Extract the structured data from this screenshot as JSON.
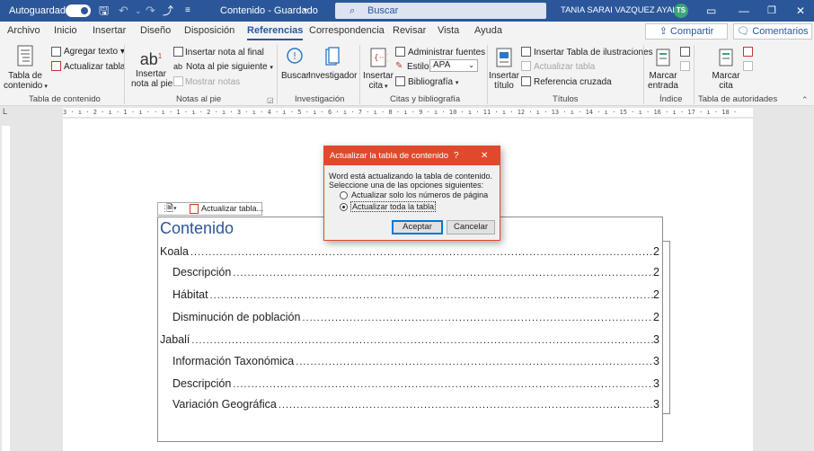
{
  "titlebar": {
    "autosave_label": "Autoguardado",
    "document_title": "Contenido  -  Guardado",
    "search_placeholder": "Buscar",
    "user_name": "TANIA SARAI VAZQUEZ AYALA",
    "user_initials": "TS"
  },
  "tabs": [
    "Archivo",
    "Inicio",
    "Insertar",
    "Diseño",
    "Disposición",
    "Referencias",
    "Correspondencia",
    "Revisar",
    "Vista",
    "Ayuda"
  ],
  "active_tab": "Referencias",
  "share_label": "Compartir",
  "comments_label": "Comentarios",
  "ribbon": {
    "toc_button": "Tabla de",
    "toc_button2": "contenido",
    "add_text": "Agregar texto",
    "update_table": "Actualizar tabla",
    "group_toc": "Tabla de contenido",
    "insert_footnote": "Insertar",
    "insert_footnote2": "nota al pie",
    "insert_endnote": "Insertar nota al final",
    "next_footnote": "Nota al pie siguiente",
    "show_notes": "Mostrar notas",
    "group_footnotes": "Notas al pie",
    "search": "Buscar",
    "researcher": "Investigador",
    "group_research": "Investigación",
    "insert_citation": "Insertar",
    "insert_citation2": "cita",
    "manage_sources": "Administrar fuentes",
    "style_label": "Estilo:",
    "style_value": "APA",
    "bibliography": "Bibliografía",
    "group_citations": "Citas y bibliografía",
    "insert_caption": "Insertar",
    "insert_caption2": "título",
    "insert_table_figures": "Insertar Tabla de ilustraciones",
    "update_table_figures": "Actualizar tabla",
    "cross_reference": "Referencia cruzada",
    "group_captions": "Títulos",
    "mark_entry": "Marcar",
    "mark_entry2": "entrada",
    "group_index": "Índice",
    "mark_citation": "Marcar",
    "mark_citation2": "cita",
    "group_authorities": "Tabla de autoridades"
  },
  "ruler_text": "3 · ı · 2 · ı · 1 · ı ·   · ı · 1 · ı · 2 · ı · 3 · ı · 4 · ı · 5 · ı · 6 · ı · 7 · ı · 8 · ı · 9 · ı · 10 · ı · 11 · ı · 12 · ı · 13 · ı · 14 · ı · 15 · ı · 16 · ı · 17 · ı · 18 ·",
  "toc_toolbar_label": "Actualizar tabla...",
  "toc": {
    "title": "Contenido",
    "entries": [
      {
        "text": "Koala",
        "page": "2",
        "level": 1
      },
      {
        "text": "Descripción",
        "page": "2",
        "level": 2
      },
      {
        "text": "Hábitat",
        "page": "2",
        "level": 2
      },
      {
        "text": "Disminución de población",
        "page": "2",
        "level": 2
      },
      {
        "text": "Jabalí",
        "page": "3",
        "level": 1
      },
      {
        "text": "Información Taxonómica",
        "page": "3",
        "level": 2
      },
      {
        "text": "Descripción",
        "page": "3",
        "level": 2
      },
      {
        "text": "Variación Geográfica",
        "page": "3",
        "level": 2
      }
    ]
  },
  "dialog": {
    "title": "Actualizar la tabla de contenido",
    "help": "?",
    "close": "✕",
    "message1": "Word está actualizando la tabla de contenido.",
    "message2": "Seleccione una de las opciones siguientes:",
    "option1": "Actualizar solo los números de página",
    "option2": "Actualizar toda la tabla",
    "selected_option": "option2",
    "ok": "Aceptar",
    "cancel": "Cancelar"
  }
}
